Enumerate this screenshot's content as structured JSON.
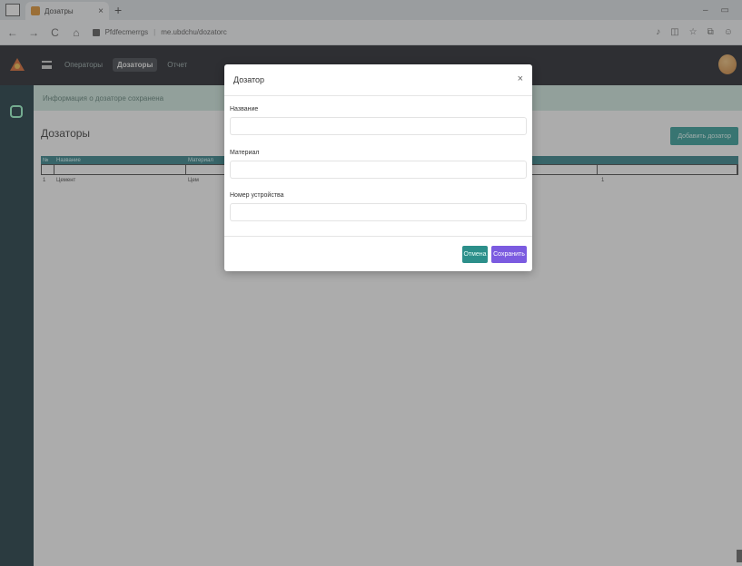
{
  "browser": {
    "tab_title": "Дозатры",
    "url_host": "Pfdfecmerrgs",
    "url_path": "me.ubdchu/dozatorc"
  },
  "app": {
    "menu": [
      "Операторы",
      "Дозаторы",
      "Отчет"
    ],
    "alert": "Информация о дозаторе сохранена",
    "page_title": "Дозаторы",
    "add_button": "Добавить дозатор",
    "table": {
      "headers": [
        "№",
        "Название",
        "Материал",
        ""
      ],
      "rows": [
        [
          "1",
          "Цемент",
          "Цем",
          "1"
        ]
      ]
    }
  },
  "modal": {
    "title": "Дозатор",
    "close": "×",
    "field_name_label": "Название",
    "field_material_label": "Материал",
    "field_device_label": "Номер устройства",
    "cancel_label": "Отмена",
    "save_label": "Сохранить"
  },
  "colors": {
    "app_bar": "#1a1d23",
    "sidebar": "#15323b",
    "alert_bg": "#cfe9e0",
    "primary_teal": "#2c9c96",
    "save_purple": "#7b5be0"
  }
}
